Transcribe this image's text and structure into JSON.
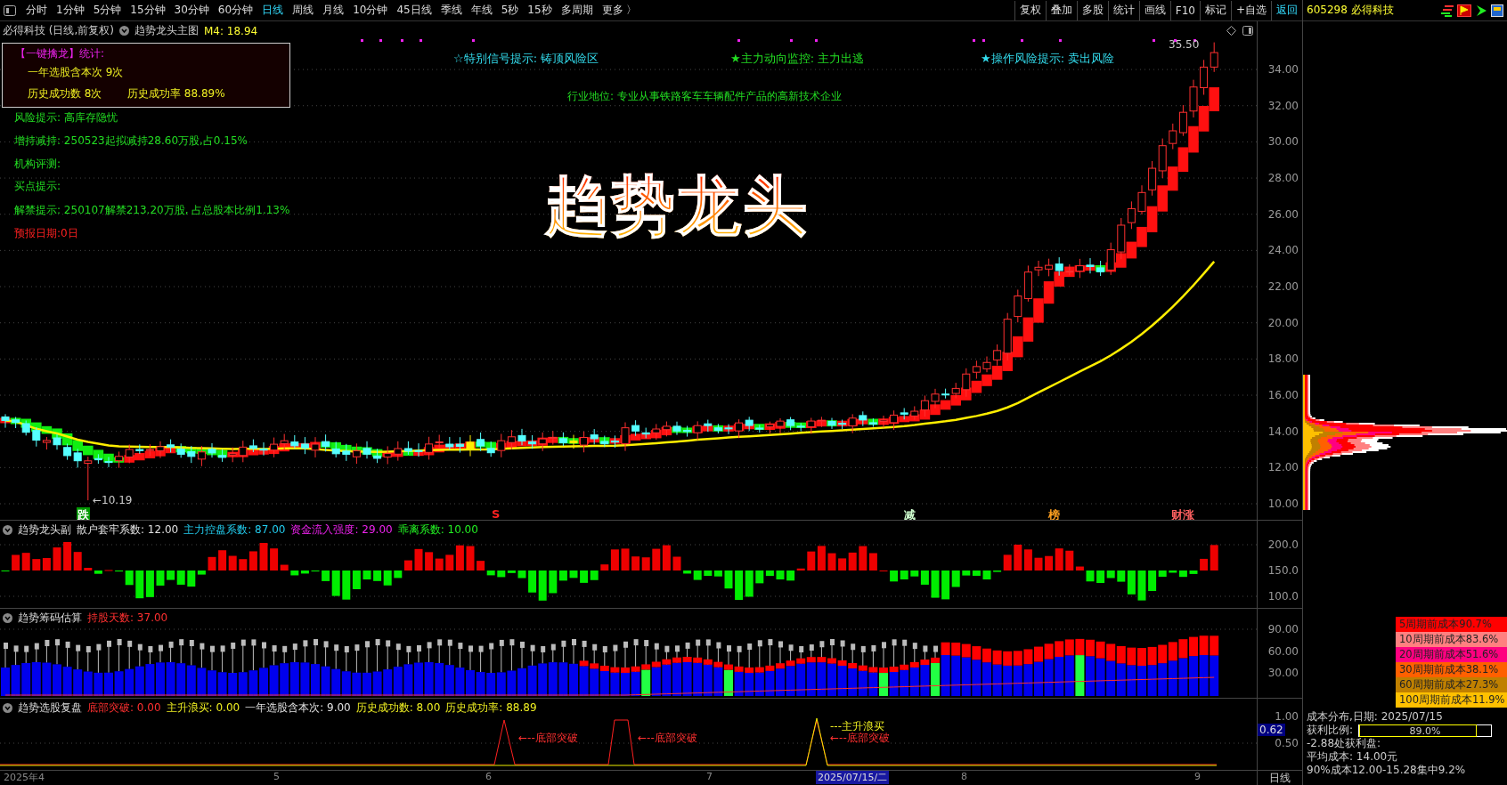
{
  "toolbar": {
    "periods": [
      {
        "label": "分时",
        "selected": false
      },
      {
        "label": "1分钟",
        "selected": false
      },
      {
        "label": "5分钟",
        "selected": false
      },
      {
        "label": "15分钟",
        "selected": false
      },
      {
        "label": "30分钟",
        "selected": false
      },
      {
        "label": "60分钟",
        "selected": false
      },
      {
        "label": "日线",
        "selected": true
      },
      {
        "label": "周线",
        "selected": false
      },
      {
        "label": "月线",
        "selected": false
      },
      {
        "label": "10分钟",
        "selected": false
      },
      {
        "label": "45日线",
        "selected": false
      },
      {
        "label": "季线",
        "selected": false
      },
      {
        "label": "年线",
        "selected": false
      },
      {
        "label": "5秒",
        "selected": false
      },
      {
        "label": "15秒",
        "selected": false
      },
      {
        "label": "多周期",
        "selected": false
      },
      {
        "label": "更多 〉",
        "selected": false
      }
    ],
    "tools": [
      {
        "label": "复权",
        "highlight": false
      },
      {
        "label": "叠加",
        "highlight": false
      },
      {
        "label": "多股",
        "highlight": false
      },
      {
        "label": "统计",
        "highlight": false
      },
      {
        "label": "画线",
        "highlight": false
      },
      {
        "label": "F10",
        "highlight": false
      },
      {
        "label": "标记",
        "highlight": false
      },
      {
        "label": "+自选",
        "highlight": false
      },
      {
        "label": "返回",
        "highlight": true
      }
    ],
    "stock": "605298 必得科技"
  },
  "main_chart": {
    "title": "必得科技 (日线,前复权)",
    "indicator": "趋势龙头主图",
    "m4": "M4: 18.94",
    "stats_box": {
      "title": "【一键擒龙】统计:",
      "selections": "一年选股含本次 9次",
      "success_count": "历史成功数 8次",
      "success_rate": "历史成功率 88.89%"
    },
    "signals": [
      {
        "text": "☆特别信号提示: 铸顶风险区",
        "color": "#33ddee"
      },
      {
        "text": "★主力动向监控: 主力出逃",
        "color": "#22dd22"
      },
      {
        "text": "★操作风险提示: 卖出风险",
        "color": "#33ddee"
      }
    ],
    "industry": "行业地位: 专业从事铁路客车车辆配件产品的高新技术企业",
    "notes": [
      {
        "text": "风险提示: 高库存隐忧",
        "kind": "info"
      },
      {
        "text": "增持减持: 250523起拟减持28.60万股,占0.15%",
        "kind": "info"
      },
      {
        "text": "机构评测:",
        "kind": "info"
      },
      {
        "text": "买点提示:",
        "kind": "info"
      },
      {
        "text": "解禁提示: 250107解禁213.20万股, 占总股本比例1.13%",
        "kind": "info"
      },
      {
        "text": "预报日期:0日",
        "kind": "alert"
      }
    ],
    "big_title": "趋势龙头",
    "high_label": "35.50",
    "low_label": "←10.19",
    "markers": [
      {
        "text": "跌",
        "kind": "badge",
        "color": "#009900"
      },
      {
        "text": "S",
        "kind": "label",
        "color": "#ff2020"
      },
      {
        "text": "减",
        "kind": "label",
        "color": "#d0ffd0"
      },
      {
        "text": "榜",
        "kind": "label",
        "color": "#ffa020"
      },
      {
        "text": "财涨",
        "kind": "label",
        "color": "#ff6060"
      }
    ],
    "y_ticks": [
      "34.00",
      "32.00",
      "30.00",
      "28.00",
      "26.00",
      "24.00",
      "22.00",
      "20.00",
      "18.00",
      "16.00",
      "14.00",
      "12.00",
      "10.00"
    ]
  },
  "sub_panels": [
    {
      "name": "趋势龙头副",
      "params": [
        {
          "text": "散户套牢系数: 12.00",
          "color": "#e0e0e0"
        },
        {
          "text": "主力控盘系数: 87.00",
          "color": "#22ccee"
        },
        {
          "text": "资金流入强度: 29.00",
          "color": "#ee22ee"
        },
        {
          "text": "乖离系数: 10.00",
          "color": "#22ee22"
        }
      ],
      "y_ticks": [
        "200.0",
        "150.0",
        "100.0"
      ]
    },
    {
      "name": "趋势筹码估算",
      "params": [
        {
          "text": "持股天数: 37.00",
          "color": "#ff3030"
        }
      ],
      "y_ticks": [
        "90.00",
        "60.00",
        "30.00"
      ]
    },
    {
      "name": "趋势选股复盘",
      "params": [
        {
          "text": "底部突破: 0.00",
          "color": "#ff3030"
        },
        {
          "text": "主升浪买: 0.00",
          "color": "#eeee22"
        },
        {
          "text": "一年选股含本次: 9.00",
          "color": "#e0e0e0"
        },
        {
          "text": "历史成功数: 8.00",
          "color": "#eeee22"
        },
        {
          "text": "历史成功率: 88.89",
          "color": "#eeee22"
        }
      ],
      "y_ticks": [
        "1.00",
        "0.62",
        "0.50"
      ],
      "annotations": [
        "←--底部突破",
        "←--底部突破",
        "---主升浪买",
        "←--底部突破"
      ]
    }
  ],
  "date_axis": {
    "labels": [
      "2025年4",
      "5",
      "6",
      "7",
      "8",
      "9"
    ],
    "cursor_date": "2025/07/15/二",
    "period": "日线"
  },
  "cost_legend": [
    {
      "text": "5周期前成本90.7%",
      "color": "#ff0000"
    },
    {
      "text": "10周期前成本83.6%",
      "color": "#ff8080"
    },
    {
      "text": "20周期前成本51.6%",
      "color": "#ff0080"
    },
    {
      "text": "30周期前成本38.1%",
      "color": "#ff6000"
    },
    {
      "text": "60周期前成本27.3%",
      "color": "#c08000"
    },
    {
      "text": "100周期前成本11.9%",
      "color": "#ffc000"
    }
  ],
  "cost_info": {
    "date": "成本分布,日期: 2025/07/15",
    "profit_label": "获利比例:",
    "profit_value": "89.0%",
    "level": 0.89,
    "profit_line": "-2.88处获利盘:",
    "avg_cost": "平均成本:  14.00元",
    "range": "90%成本12.00-15.28集中9.2%"
  }
}
